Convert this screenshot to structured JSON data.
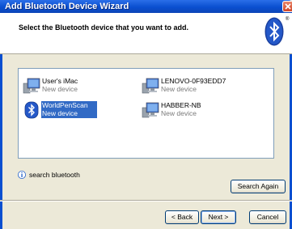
{
  "window": {
    "title": "Add Bluetooth Device Wizard"
  },
  "header": {
    "instruction": "Select the Bluetooth device that you want to add.",
    "logo_icon": "bluetooth-logo",
    "registered_mark": "®"
  },
  "devices": [
    {
      "name": "User's iMac",
      "status": "New device",
      "icon": "computer-icon",
      "selected": false
    },
    {
      "name": "LENOVO-0F93EDD7",
      "status": "New device",
      "icon": "computer-icon",
      "selected": false
    },
    {
      "name": "WorldPenScan",
      "status": "New device",
      "icon": "bluetooth-icon",
      "selected": true
    },
    {
      "name": "HABBER-NB",
      "status": "New device",
      "icon": "computer-icon",
      "selected": false
    }
  ],
  "hint": {
    "icon": "info-icon",
    "text": "search bluetooth"
  },
  "buttons": {
    "search_again": "Search Again",
    "back": "< Back",
    "next": "Next >",
    "cancel": "Cancel"
  },
  "colors": {
    "titlebar": "#0a4fd0",
    "selection": "#316ac5",
    "dialog_bg": "#ece9d8"
  }
}
